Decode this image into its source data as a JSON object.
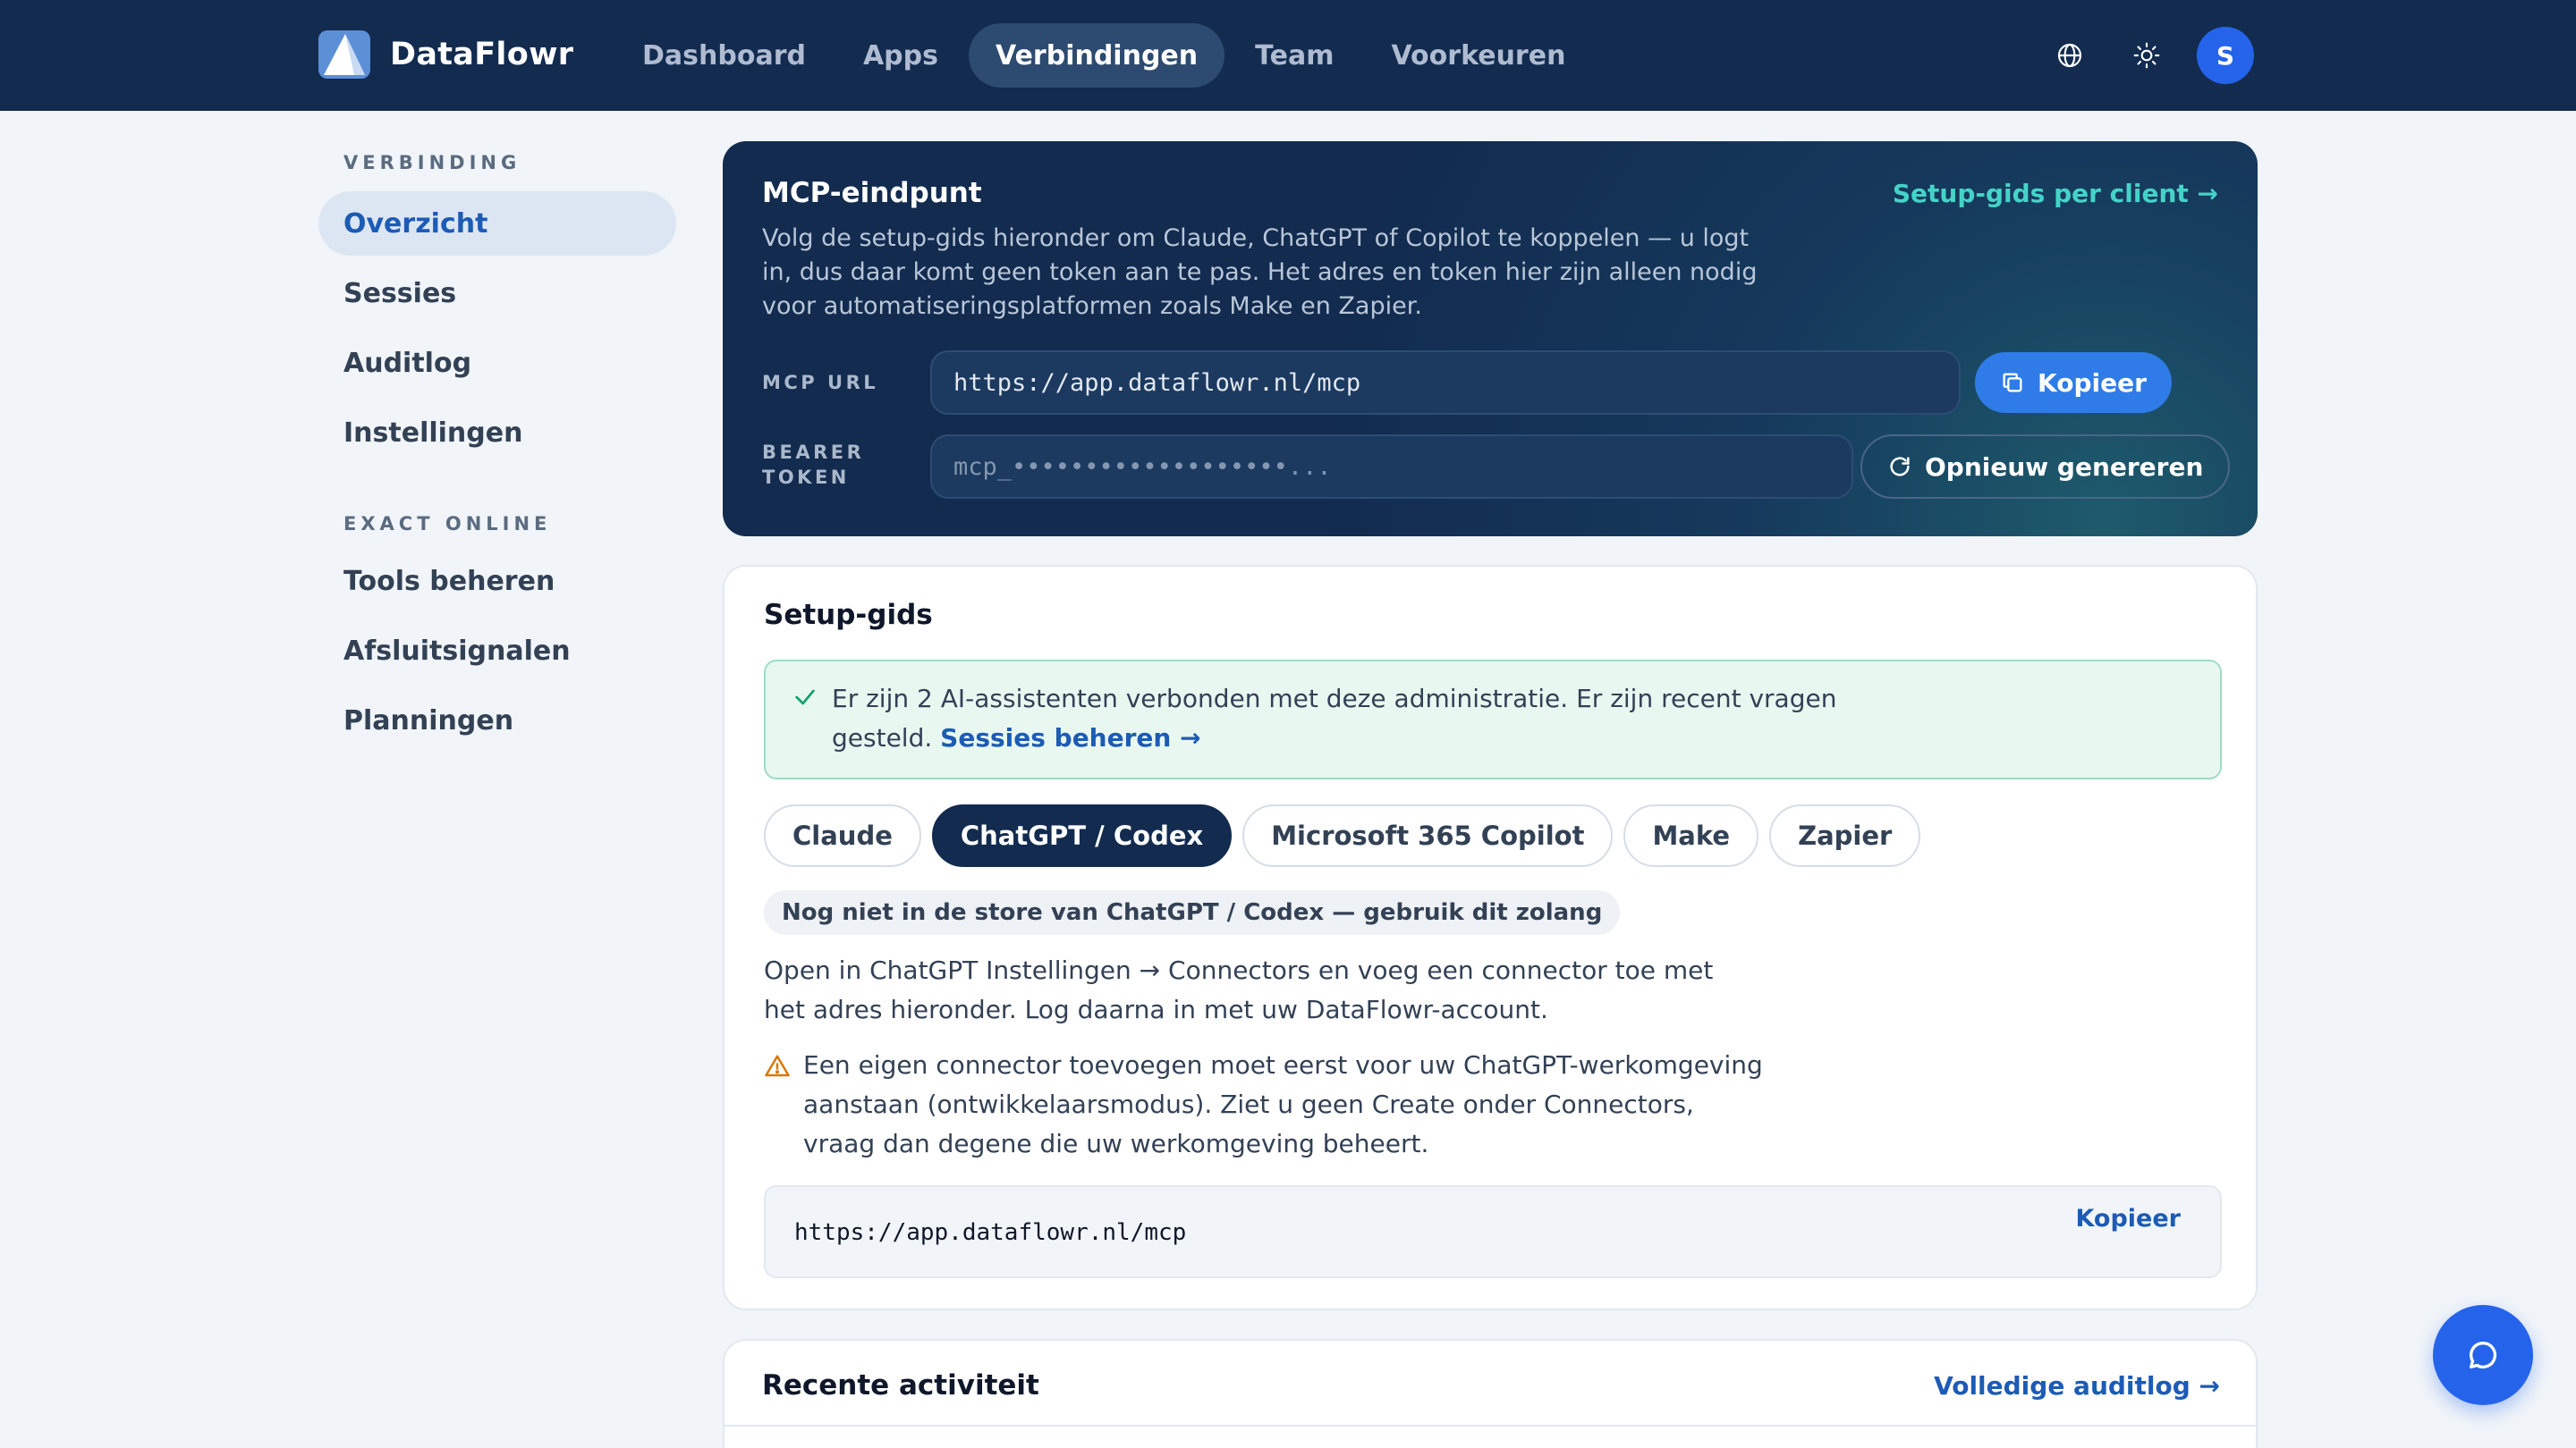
{
  "brand": {
    "name": "DataFlowr"
  },
  "nav": {
    "items": [
      {
        "label": "Dashboard",
        "active": false
      },
      {
        "label": "Apps",
        "active": false
      },
      {
        "label": "Verbindingen",
        "active": true
      },
      {
        "label": "Team",
        "active": false
      },
      {
        "label": "Voorkeuren",
        "active": false
      }
    ],
    "icons": [
      "globe-icon",
      "sun-icon"
    ],
    "avatar_initial": "S"
  },
  "sidebar": {
    "groups": [
      {
        "label": "VERBINDING",
        "items": [
          "Overzicht",
          "Sessies",
          "Auditlog",
          "Instellingen"
        ]
      },
      {
        "label": "EXACT ONLINE",
        "items": [
          "Tools beheren",
          "Afsluitsignalen",
          "Planningen"
        ]
      }
    ],
    "active_item": "Overzicht"
  },
  "mcp": {
    "title": "MCP-eindpunt",
    "guide_link": "Setup-gids per client →",
    "description": "Volg de setup-gids hieronder om Claude, ChatGPT of Copilot te koppelen — u logt in, dus daar komt geen token aan te pas. Het adres en token hier zijn alleen nodig voor automatiseringsplatformen zoals Make en Zapier.",
    "url_label": "MCP URL",
    "url_value": "https://app.dataflowr.nl/mcp",
    "copy_label": "Kopieer",
    "token_label": "BEARER TOKEN",
    "token_value": "mcp_•••••••••••••••••••...",
    "regen_label": "Opnieuw genereren"
  },
  "setup": {
    "title": "Setup-gids",
    "alert_text": "Er zijn 2 AI-assistenten verbonden met deze administratie. Er zijn recent vragen gesteld.",
    "alert_link": "Sessies beheren →",
    "tabs": [
      {
        "label": "Claude",
        "active": false
      },
      {
        "label": "ChatGPT / Codex",
        "active": true
      },
      {
        "label": "Microsoft 365 Copilot",
        "active": false
      },
      {
        "label": "Make",
        "active": false
      },
      {
        "label": "Zapier",
        "active": false
      }
    ],
    "notice": "Nog niet in de store van ChatGPT / Codex — gebruik dit zolang",
    "instructions": "Open in ChatGPT Instellingen → Connectors en voeg een connector toe met het adres hieronder. Log daarna in met uw DataFlowr-account.",
    "warning": "Een eigen connector toevoegen moet eerst voor uw ChatGPT-werkomgeving aanstaan (ontwikkelaarsmodus). Ziet u geen Create onder Connectors, vraag dan degene die uw werkomgeving beheert.",
    "code_value": "https://app.dataflowr.nl/mcp",
    "code_copy": "Kopieer"
  },
  "activity": {
    "title": "Recente activiteit",
    "link": "Volledige auditlog →"
  },
  "colors": {
    "nav_bg": "#122b4f",
    "accent": "#2563eb",
    "teal_link": "#45d3c8",
    "link": "#1d5bb5",
    "success_bg": "#e8f8f1",
    "warning": "#d97706"
  }
}
